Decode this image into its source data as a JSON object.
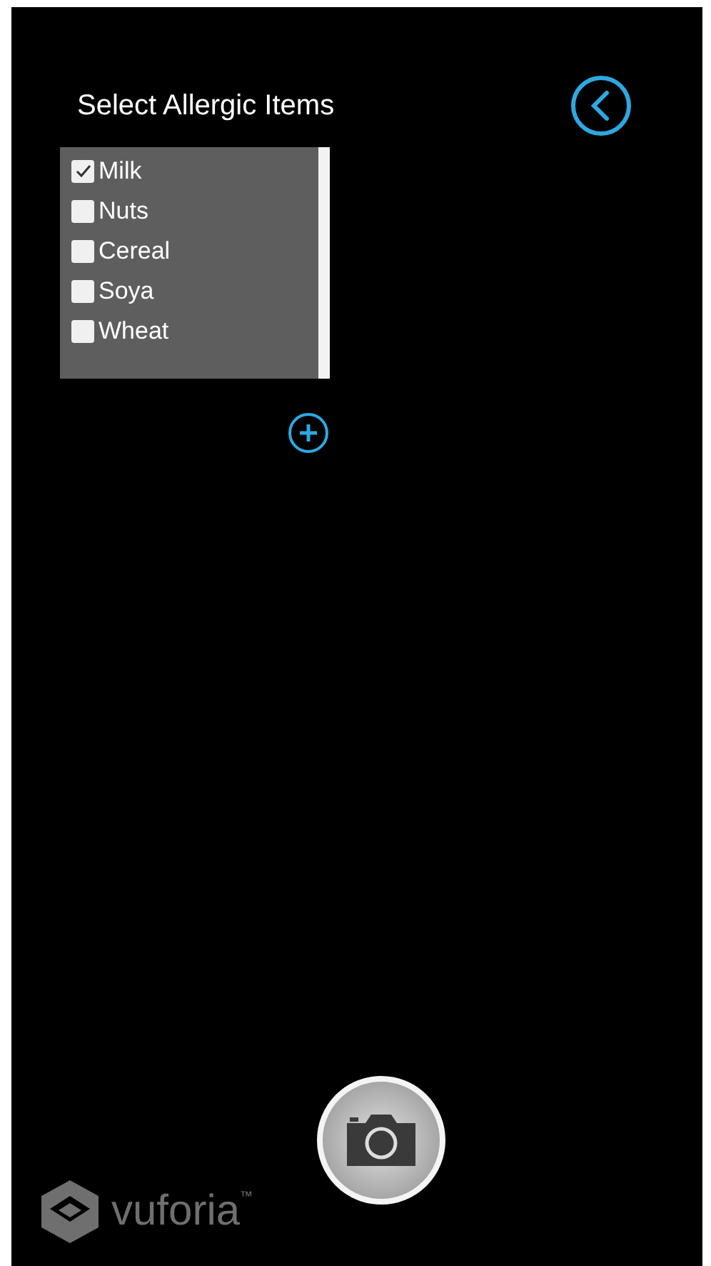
{
  "title": "Select Allergic Items",
  "items": [
    {
      "label": "Milk",
      "checked": true
    },
    {
      "label": "Nuts",
      "checked": false
    },
    {
      "label": "Cereal",
      "checked": false
    },
    {
      "label": "Soya",
      "checked": false
    },
    {
      "label": "Wheat",
      "checked": false
    }
  ],
  "brand": {
    "name": "vuforia",
    "mark": "™"
  }
}
